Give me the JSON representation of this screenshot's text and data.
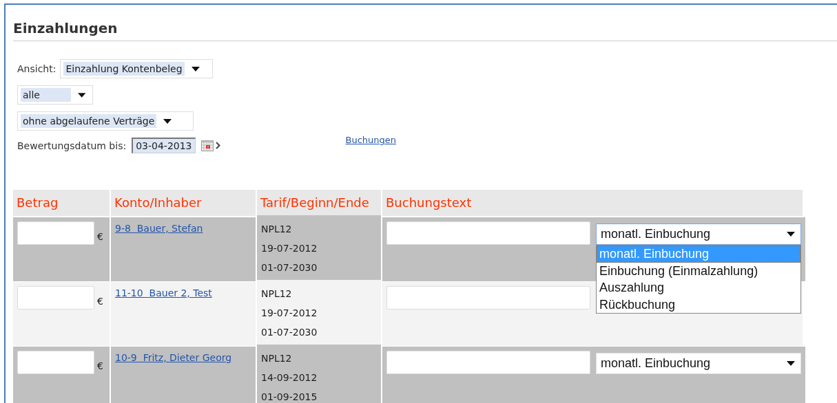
{
  "page": {
    "title": "Einzahlungen"
  },
  "filters": {
    "view_label": "Ansicht:",
    "view": "Einzahlung Kontenbeleg",
    "scope": "alle",
    "contracts": "ohne abgelaufene Verträge",
    "date_label": "Bewertungsdatum bis:",
    "date": "03-04-2013",
    "link": "Buchungen"
  },
  "table": {
    "columns": [
      "Betrag",
      "Konto/Inhaber",
      "Tarif/Beginn/Ende",
      "Buchungstext"
    ],
    "rows": [
      {
        "currency": "€",
        "account": "9-8  Bauer, Stefan",
        "tariff": "NPL12",
        "start": "19-07-2012",
        "end": "01-07-2030",
        "booking_type": "monatl. Einbuchung",
        "open": true,
        "options": [
          {
            "label": "monatl. Einbuchung",
            "selected": true
          },
          {
            "label": "Einbuchung (Einmalzahlung)",
            "selected": false
          },
          {
            "label": "Auszahlung",
            "selected": false
          },
          {
            "label": "Rückbuchung",
            "selected": false
          }
        ]
      },
      {
        "currency": "€",
        "account": "11-10  Bauer 2, Test",
        "tariff": "NPL12",
        "start": "19-07-2012",
        "end": "01-07-2030"
      },
      {
        "currency": "€",
        "account": "10-9  Fritz, Dieter Georg",
        "tariff": "NPL12",
        "start": "14-09-2012",
        "end": "01-09-2015",
        "booking_type": "monatl. Einbuchung",
        "open": false
      }
    ]
  }
}
